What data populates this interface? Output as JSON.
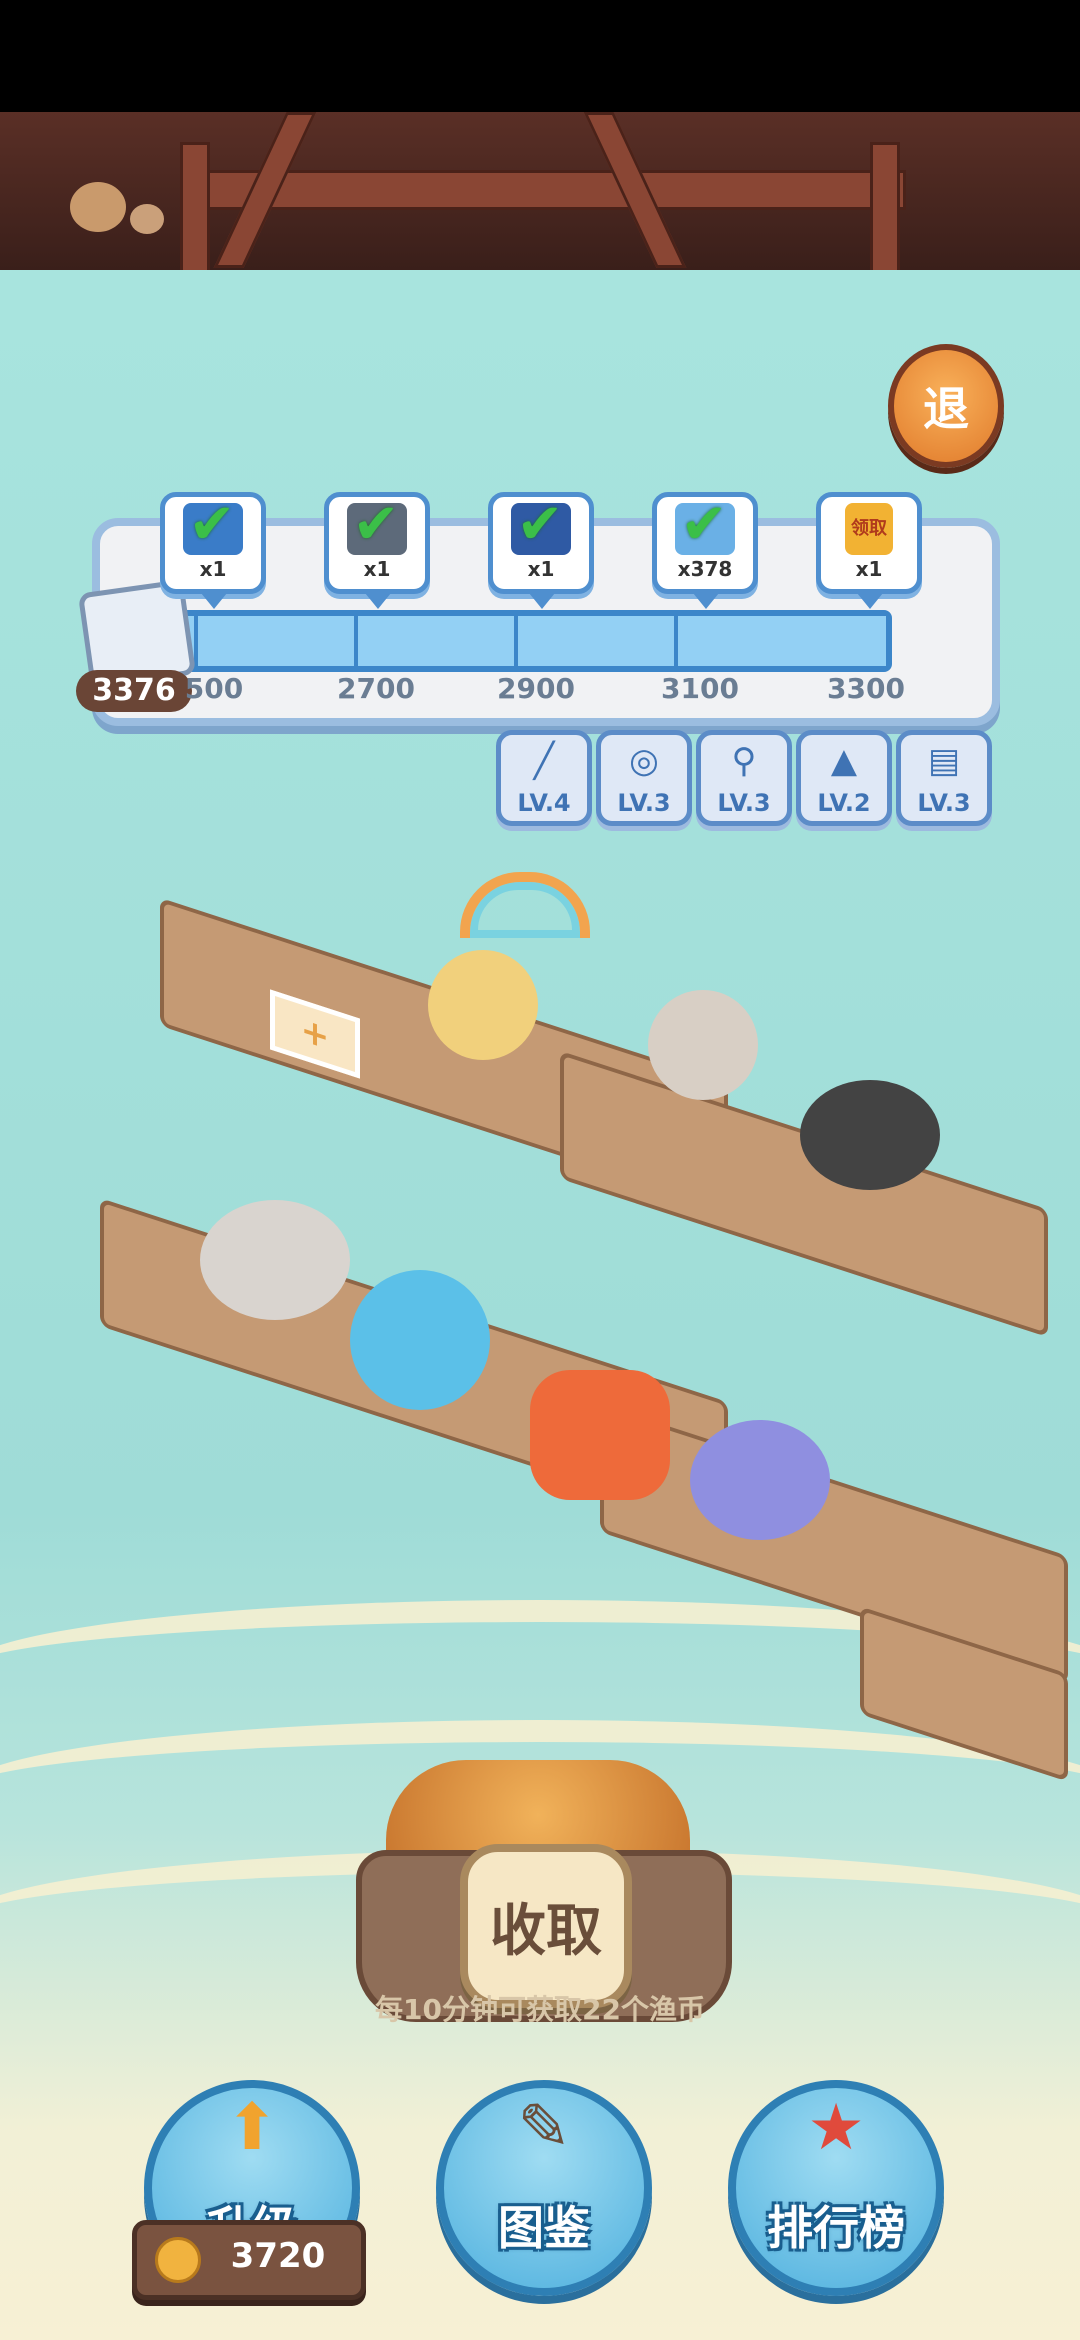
{
  "game": {
    "exit_label": "退",
    "score": "3376",
    "milestones": [
      "2500",
      "2700",
      "2900",
      "3100",
      "3300"
    ],
    "milestones_display": [
      "500",
      "2700",
      "2900",
      "3100",
      "3300"
    ],
    "progress_percent": 100,
    "rewards": [
      {
        "qty": "x1",
        "claimed": true
      },
      {
        "qty": "x1",
        "claimed": true
      },
      {
        "qty": "x1",
        "claimed": true
      },
      {
        "qty": "x378",
        "claimed": true
      },
      {
        "qty": "x1",
        "claimed": false,
        "label": "领取"
      }
    ],
    "gear": [
      {
        "icon": "fishing-rod-icon",
        "level": "LV.4"
      },
      {
        "icon": "reel-icon",
        "level": "LV.3"
      },
      {
        "icon": "hook-icon",
        "level": "LV.3"
      },
      {
        "icon": "hat-icon",
        "level": "LV.2"
      },
      {
        "icon": "bench-icon",
        "level": "LV.3"
      }
    ],
    "collect": {
      "label": "收取",
      "tip": "每10分钟可获取22个渔币"
    },
    "bottom": {
      "upgrade": "升级",
      "guide": "图鉴",
      "ranking": "排行榜",
      "coins": "3720"
    }
  }
}
